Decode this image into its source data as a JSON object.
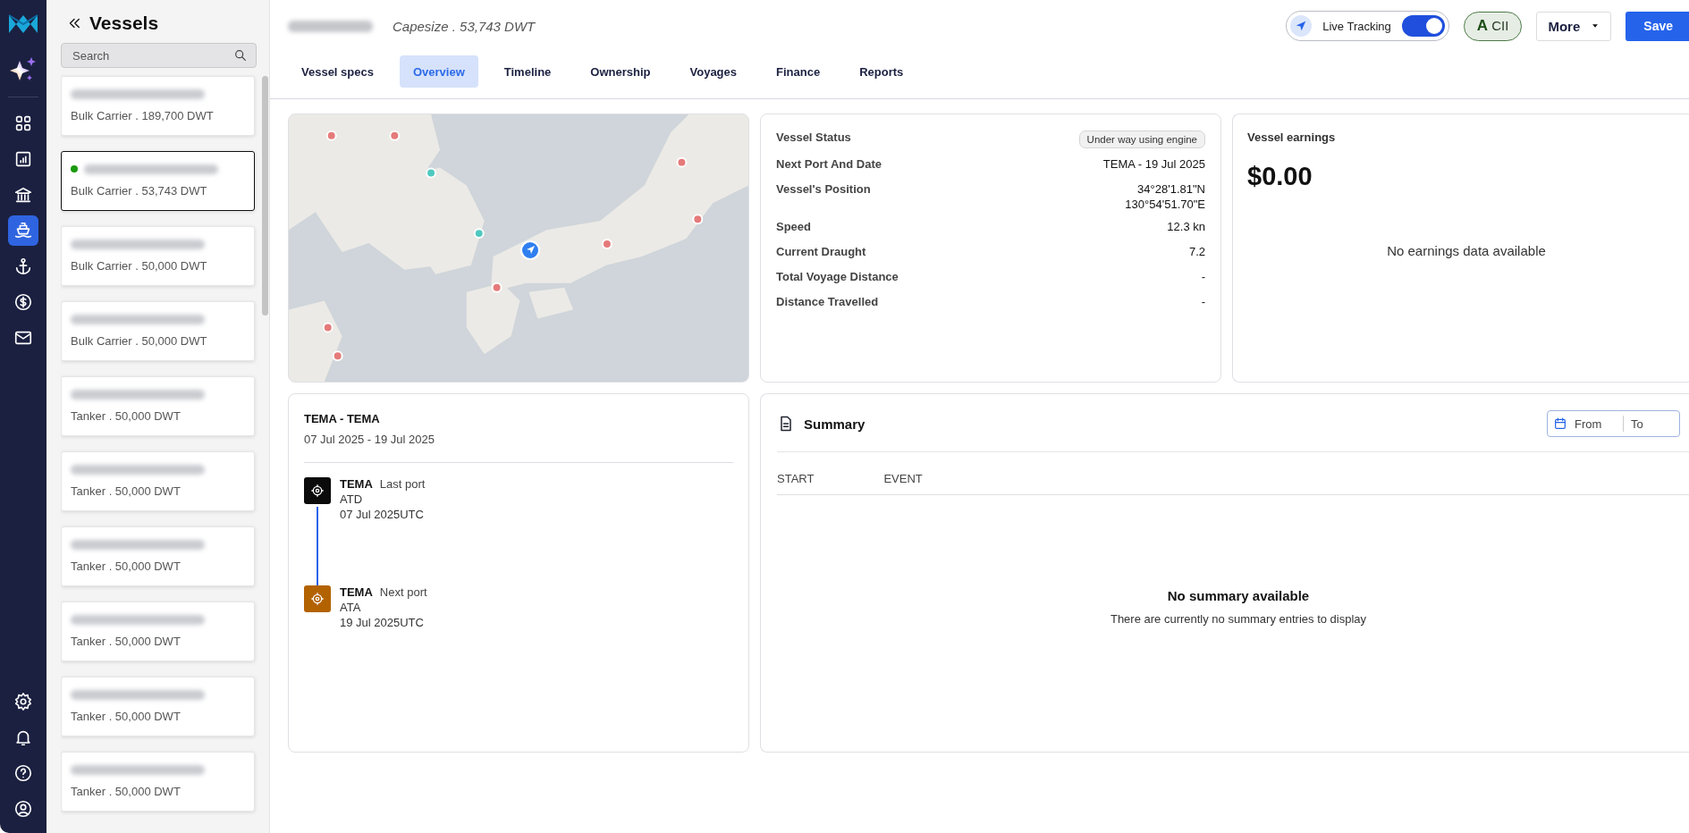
{
  "nav_rail": {
    "top_items": [
      {
        "kind": "dashboard",
        "selected": false
      },
      {
        "kind": "reports",
        "selected": false
      },
      {
        "kind": "bank",
        "selected": false
      },
      {
        "kind": "vessel",
        "selected": true
      },
      {
        "kind": "anchor",
        "selected": false
      },
      {
        "kind": "finance",
        "selected": false
      },
      {
        "kind": "mail",
        "selected": false
      }
    ],
    "bottom_items": [
      {
        "kind": "settings",
        "selected": false
      },
      {
        "kind": "bell",
        "selected": false
      },
      {
        "kind": "help",
        "selected": false
      },
      {
        "kind": "account",
        "selected": false
      }
    ]
  },
  "vessels_panel": {
    "title": "Vessels",
    "search": {
      "placeholder": "Search"
    },
    "vessels": [
      {
        "subtitle": "Bulk Carrier . 189,700 DWT",
        "selected": false,
        "tracking": false
      },
      {
        "subtitle": "Bulk Carrier . 53,743 DWT",
        "selected": true,
        "tracking": true
      },
      {
        "subtitle": "Bulk Carrier . 50,000 DWT",
        "selected": false,
        "tracking": false
      },
      {
        "subtitle": "Bulk Carrier . 50,000 DWT",
        "selected": false,
        "tracking": false
      },
      {
        "subtitle": "Tanker . 50,000 DWT",
        "selected": false,
        "tracking": false
      },
      {
        "subtitle": "Tanker . 50,000 DWT",
        "selected": false,
        "tracking": false
      },
      {
        "subtitle": "Tanker . 50,000 DWT",
        "selected": false,
        "tracking": false
      },
      {
        "subtitle": "Tanker . 50,000 DWT",
        "selected": false,
        "tracking": false
      },
      {
        "subtitle": "Tanker . 50,000 DWT",
        "selected": false,
        "tracking": false
      },
      {
        "subtitle": "Tanker . 50,000 DWT",
        "selected": false,
        "tracking": false
      }
    ]
  },
  "header": {
    "vessel_class": "Capesize . 53,743 DWT",
    "live_tracking": {
      "label": "Live Tracking",
      "on": true
    },
    "cii": {
      "grade": "A",
      "label": "CII"
    },
    "more": "More",
    "save": "Save"
  },
  "tabs": [
    {
      "label": "Vessel specs",
      "selected": false
    },
    {
      "label": "Overview",
      "selected": true
    },
    {
      "label": "Timeline",
      "selected": false
    },
    {
      "label": "Ownership",
      "selected": false
    },
    {
      "label": "Voyages",
      "selected": false
    },
    {
      "label": "Finance",
      "selected": false
    },
    {
      "label": "Reports",
      "selected": false
    }
  ],
  "vessel_status": {
    "rows": [
      {
        "label": "Vessel Status",
        "kind": "badge",
        "lines": [
          "Under way using engine"
        ]
      },
      {
        "label": "Next Port And Date",
        "kind": "text",
        "lines": [
          "TEMA - 19 Jul 2025"
        ]
      },
      {
        "label": "Vessel's Position",
        "kind": "text",
        "lines": [
          "34°28'1.81\"N",
          "130°54'51.70\"E"
        ]
      },
      {
        "label": "Speed",
        "kind": "text",
        "lines": [
          "12.3 kn"
        ]
      },
      {
        "label": "Current Draught",
        "kind": "text",
        "lines": [
          "7.2"
        ]
      },
      {
        "label": "Total Voyage Distance",
        "kind": "text",
        "lines": [
          "-"
        ]
      },
      {
        "label": "Distance Travelled",
        "kind": "text",
        "lines": [
          "-"
        ]
      }
    ]
  },
  "earnings": {
    "title": "Vessel earnings",
    "amount": "$0.00",
    "empty": "No earnings data available"
  },
  "voyage": {
    "route": "TEMA - TEMA",
    "dates": "07 Jul 2025 - 19 Jul 2025",
    "ports": [
      {
        "kind": "last",
        "port": "TEMA",
        "role": "Last port",
        "event": "ATD",
        "time": "07 Jul 2025UTC"
      },
      {
        "kind": "next",
        "port": "TEMA",
        "role": "Next port",
        "event": "ATA",
        "time": "19 Jul 2025UTC"
      }
    ]
  },
  "summary": {
    "title": "Summary",
    "from_placeholder": "From",
    "to_placeholder": "To",
    "columns": [
      "START",
      "EVENT"
    ],
    "empty_title": "No summary available",
    "empty_text": "There are currently no summary entries to display"
  }
}
